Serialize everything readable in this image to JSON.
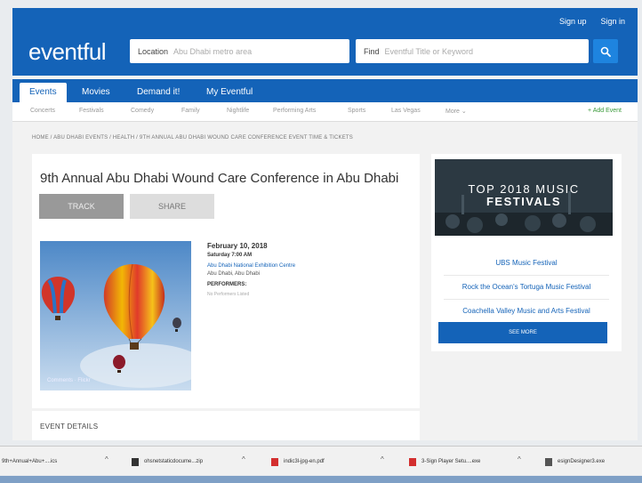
{
  "header": {
    "top_links": [
      "Sign up",
      "Sign in"
    ],
    "logo": "eventful",
    "location": {
      "label": "Location",
      "value": "Abu Dhabi metro area"
    },
    "find": {
      "label": "Find",
      "placeholder": "Eventful Title or Keyword"
    },
    "search_icon": "search-icon"
  },
  "main_tabs": [
    "Events",
    "Movies",
    "Demand it!",
    "My Eventful"
  ],
  "active_tab": "Events",
  "categories": [
    "Concerts",
    "Festivals",
    "Comedy",
    "Family",
    "Nightlife",
    "Performing Arts",
    "Sports",
    "Las Vegas",
    "More ⌄"
  ],
  "add_event": "+ Add Event",
  "breadcrumb": "HOME / ABU DHABI EVENTS / HEALTH / 9TH ANNUAL ABU DHABI WOUND CARE CONFERENCE EVENT TIME & TICKETS",
  "event": {
    "title": "9th Annual Abu Dhabi Wound Care Conference  in Abu Dhabi",
    "track_label": "TRACK",
    "share_label": "SHARE",
    "image_caption": "Comments · Flickr",
    "date": "February 10, 2018",
    "day_time": "Saturday   7:00 AM",
    "venue": "Abu Dhabi National Exhibition Centre",
    "city": "Abu Dhabi, Abu Dhabi",
    "performers_heading": "PERFORMERS:",
    "performers": "No Performers Listed"
  },
  "details": {
    "title": "EVENT DETAILS"
  },
  "promo": {
    "banner_line1": "TOP 2018 MUSIC",
    "banner_line2": "FESTIVALS",
    "festivals": [
      "UBS Music Festival",
      "Rock the Ocean's Tortuga Music Festival",
      "Coachella Valley Music and Arts Festival"
    ],
    "see_more": "SEE MORE"
  },
  "downloads": [
    {
      "name": "9th+Annual+Abu+....ics",
      "icon": "calendar-file-icon",
      "color": "#777777"
    },
    {
      "name": "ohsnetstaticdocume...zip",
      "icon": "zip-file-icon",
      "color": "#333333"
    },
    {
      "name": "indic3l-jpg-en.pdf",
      "icon": "pdf-file-icon",
      "color": "#d32f2f"
    },
    {
      "name": "3-Sign Player Setu....exe",
      "icon": "installer-icon",
      "color": "#d32f2f"
    },
    {
      "name": "esignDesigner3.exe",
      "icon": "installer-icon",
      "color": "#555555"
    }
  ],
  "colors": {
    "brand": "#1463b8",
    "search_button": "#1e84df",
    "add_event": "#3b9a3b"
  }
}
